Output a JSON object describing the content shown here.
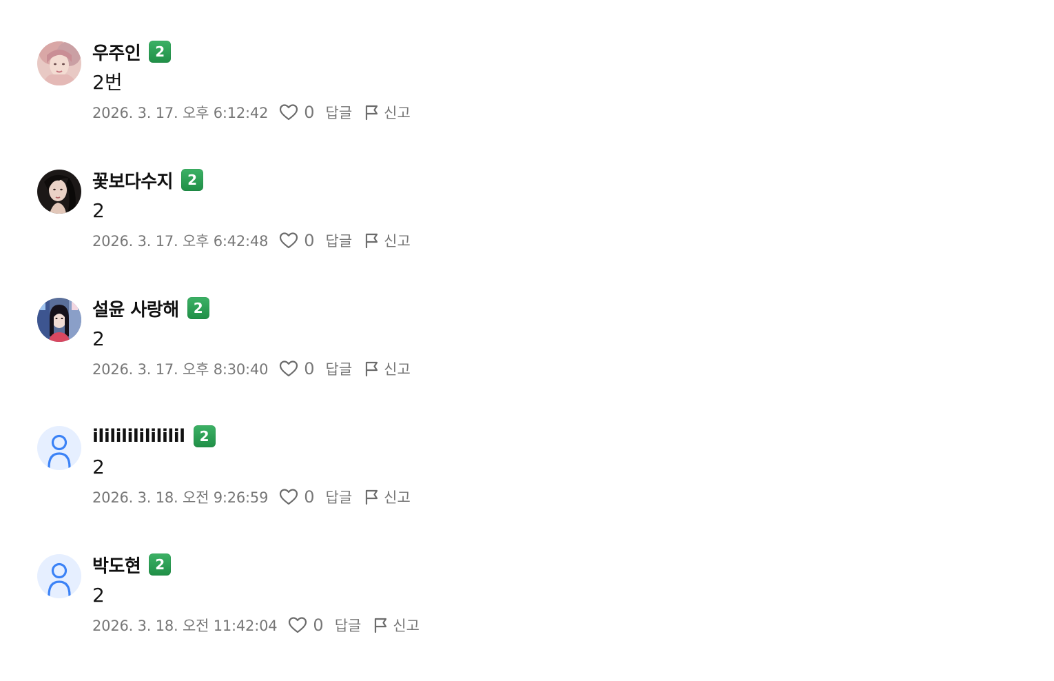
{
  "colors": {
    "badge_green": "#2a9d52",
    "meta_gray": "#777777",
    "default_avatar_bg": "#e6efff",
    "default_avatar_fg": "#3b82f6"
  },
  "comments": [
    {
      "author": "우주인",
      "badge": "2",
      "text": "2번",
      "date": "2026. 3. 17. 오후 6:12:42",
      "likes": "0",
      "reply_label": "답글",
      "report_label": "신고",
      "avatar": "photo-avatar-pink-hair"
    },
    {
      "author": "꽃보다수지",
      "badge": "2",
      "text": "2",
      "date": "2026. 3. 17. 오후 6:42:48",
      "likes": "0",
      "reply_label": "답글",
      "report_label": "신고",
      "avatar": "photo-avatar-dark-hair"
    },
    {
      "author": "설윤 사랑해",
      "badge": "2",
      "text": "2",
      "date": "2026. 3. 17. 오후 8:30:40",
      "likes": "0",
      "reply_label": "답글",
      "report_label": "신고",
      "avatar": "photo-avatar-city"
    },
    {
      "author": "ilililililililil",
      "badge": "2",
      "text": "2",
      "date": "2026. 3. 18. 오전 9:26:59",
      "likes": "0",
      "reply_label": "답글",
      "report_label": "신고",
      "avatar": "default-user-icon"
    },
    {
      "author": "박도현",
      "badge": "2",
      "text": "2",
      "date": "2026. 3. 18. 오전 11:42:04",
      "likes": "0",
      "reply_label": "답글",
      "report_label": "신고",
      "avatar": "default-user-icon"
    }
  ]
}
